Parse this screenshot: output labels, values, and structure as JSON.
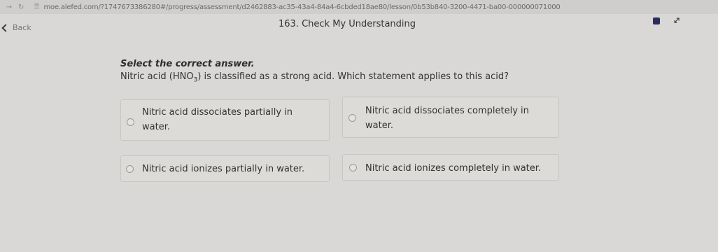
{
  "browser": {
    "back_icon": "arrow-left-icon",
    "forward_icon": "arrow-right-icon",
    "reload_icon": "reload-icon",
    "url": "moe.alefed.com/?1747673386280#/progress/assessment/d2462883-ac35-43a4-84a4-6cbded18ae80/lesson/0b53b840-3200-4471-ba00-000000071000"
  },
  "header": {
    "back_label": "Back",
    "title": "163. Check My Understanding"
  },
  "question": {
    "instruction": "Select the correct answer.",
    "text_before": "Nitric acid (HNO",
    "subscript": "3",
    "text_after": ") is classified as a strong acid. Which statement applies to this acid?"
  },
  "options": [
    {
      "line1": "Nitric acid dissociates partially in",
      "line2": "water."
    },
    {
      "line1": "Nitric acid dissociates completely in",
      "line2": "water."
    },
    {
      "line1": "Nitric acid ionizes partially in water.",
      "line2": ""
    },
    {
      "line1": "Nitric acid ionizes completely in water.",
      "line2": ""
    }
  ]
}
